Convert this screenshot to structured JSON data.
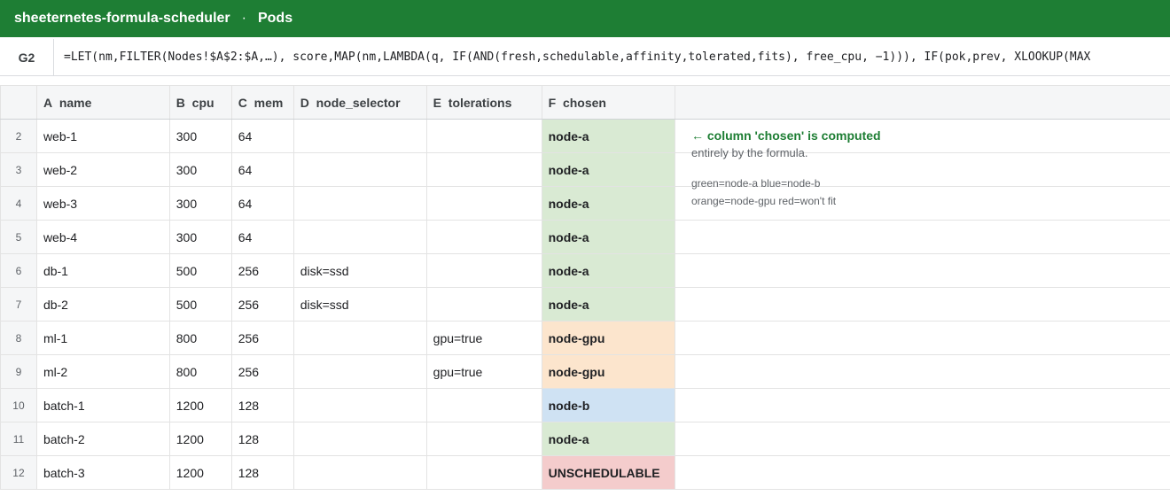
{
  "app": {
    "title": "sheeternetes-formula-scheduler",
    "separator": "·",
    "sheet": "Pods"
  },
  "formula_bar": {
    "cell": "G2",
    "formula": "=LET(nm,FILTER(Nodes!$A$2:$A,…), score,MAP(nm,LAMBDA(q, IF(AND(fresh,schedulable,affinity,tolerated,fits), free_cpu, −1))), IF(pok,prev, XLOOKUP(MAX"
  },
  "columns": [
    {
      "letter": "A",
      "name": "name"
    },
    {
      "letter": "B",
      "name": "cpu"
    },
    {
      "letter": "C",
      "name": "mem"
    },
    {
      "letter": "D",
      "name": "node_selector"
    },
    {
      "letter": "E",
      "name": "tolerations"
    },
    {
      "letter": "F",
      "name": "chosen"
    }
  ],
  "rows": [
    {
      "n": "2",
      "name": "web-1",
      "cpu": "300",
      "mem": "64",
      "node_selector": "",
      "tolerations": "",
      "chosen": "node-a"
    },
    {
      "n": "3",
      "name": "web-2",
      "cpu": "300",
      "mem": "64",
      "node_selector": "",
      "tolerations": "",
      "chosen": "node-a"
    },
    {
      "n": "4",
      "name": "web-3",
      "cpu": "300",
      "mem": "64",
      "node_selector": "",
      "tolerations": "",
      "chosen": "node-a"
    },
    {
      "n": "5",
      "name": "web-4",
      "cpu": "300",
      "mem": "64",
      "node_selector": "",
      "tolerations": "",
      "chosen": "node-a"
    },
    {
      "n": "6",
      "name": "db-1",
      "cpu": "500",
      "mem": "256",
      "node_selector": "disk=ssd",
      "tolerations": "",
      "chosen": "node-a"
    },
    {
      "n": "7",
      "name": "db-2",
      "cpu": "500",
      "mem": "256",
      "node_selector": "disk=ssd",
      "tolerations": "",
      "chosen": "node-a"
    },
    {
      "n": "8",
      "name": "ml-1",
      "cpu": "800",
      "mem": "256",
      "node_selector": "",
      "tolerations": "gpu=true",
      "chosen": "node-gpu"
    },
    {
      "n": "9",
      "name": "ml-2",
      "cpu": "800",
      "mem": "256",
      "node_selector": "",
      "tolerations": "gpu=true",
      "chosen": "node-gpu"
    },
    {
      "n": "10",
      "name": "batch-1",
      "cpu": "1200",
      "mem": "128",
      "node_selector": "",
      "tolerations": "",
      "chosen": "node-b"
    },
    {
      "n": "11",
      "name": "batch-2",
      "cpu": "1200",
      "mem": "128",
      "node_selector": "",
      "tolerations": "",
      "chosen": "node-a"
    },
    {
      "n": "12",
      "name": "batch-3",
      "cpu": "1200",
      "mem": "128",
      "node_selector": "",
      "tolerations": "",
      "chosen": "UNSCHEDULABLE"
    }
  ],
  "chosen_colors": {
    "node-a": "#d9ead3",
    "node-b": "#cfe2f3",
    "node-gpu": "#fce5cd",
    "UNSCHEDULABLE": "#f4cccc"
  },
  "notes": {
    "heading": "← column 'chosen' is computed",
    "line2": "entirely by the formula.",
    "legend1": "green=node-a  blue=node-b",
    "legend2": "orange=node-gpu  red=won't fit"
  }
}
